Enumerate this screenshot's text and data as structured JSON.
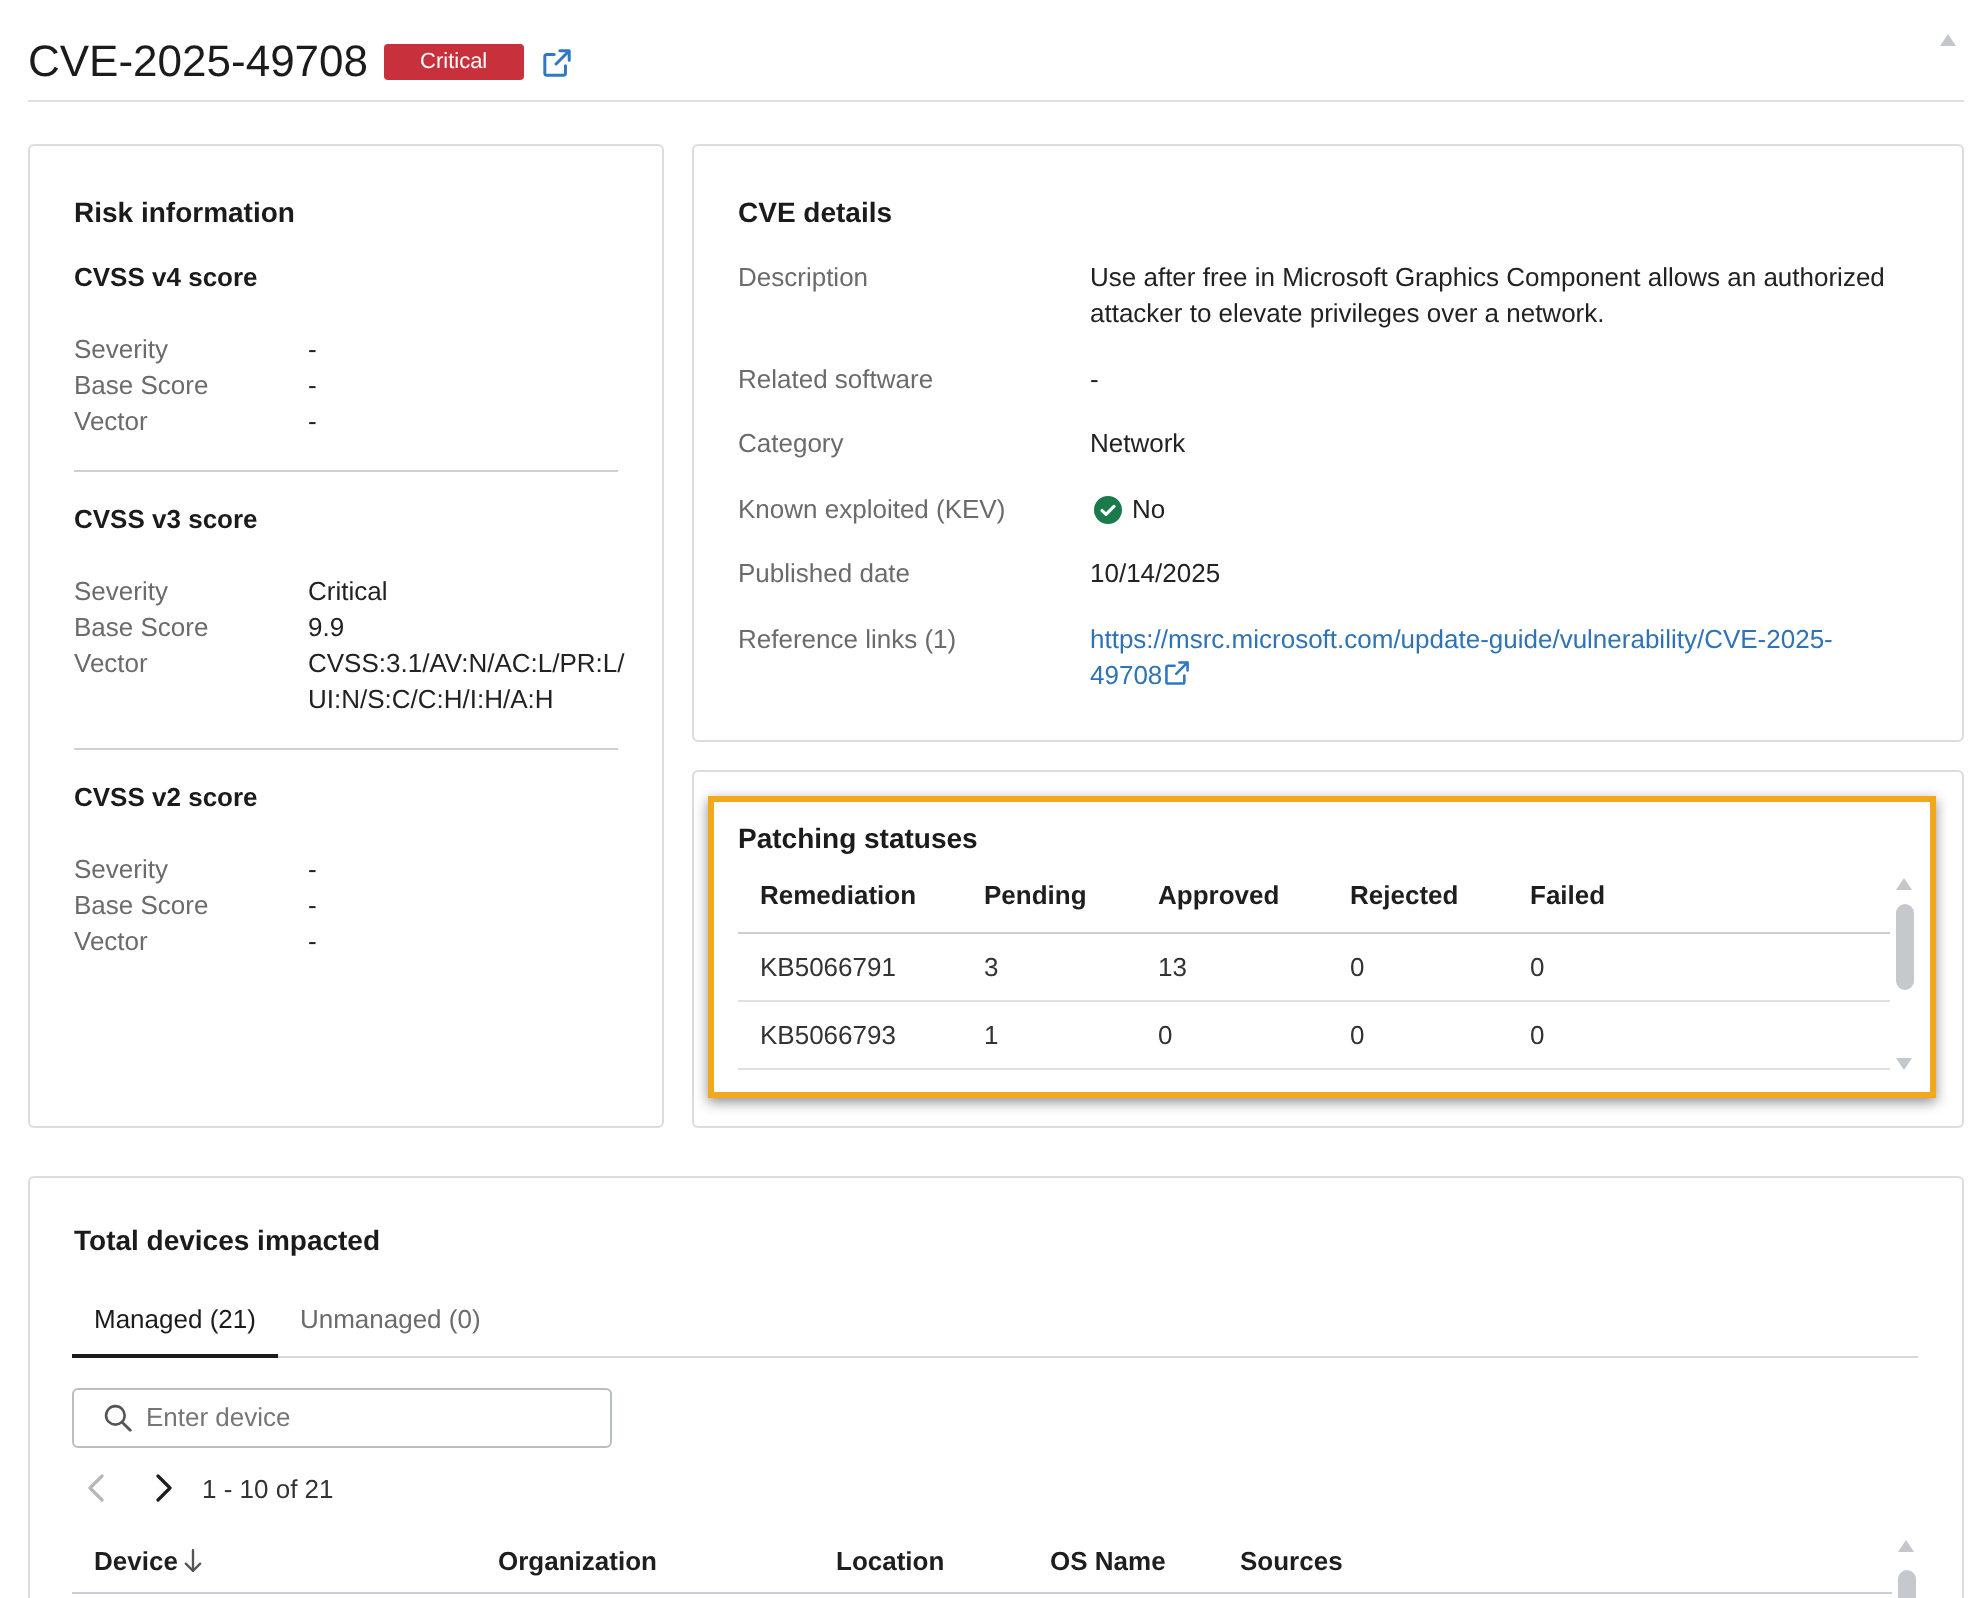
{
  "header": {
    "title": "CVE-2025-49708",
    "severity": "Critical"
  },
  "risk_information": {
    "title": "Risk information",
    "sections": [
      {
        "title": "CVSS v4 score",
        "fields": [
          {
            "label": "Severity",
            "value": "-"
          },
          {
            "label": "Base Score",
            "value": "-"
          },
          {
            "label": "Vector",
            "value": "-"
          }
        ]
      },
      {
        "title": "CVSS v3 score",
        "fields": [
          {
            "label": "Severity",
            "value": "Critical"
          },
          {
            "label": "Base Score",
            "value": "9.9"
          },
          {
            "label": "Vector",
            "value": "CVSS:3.1/AV:N/AC:L/PR:L/UI:N/S:C/C:H/I:H/A:H"
          }
        ]
      },
      {
        "title": "CVSS v2 score",
        "fields": [
          {
            "label": "Severity",
            "value": "-"
          },
          {
            "label": "Base Score",
            "value": "-"
          },
          {
            "label": "Vector",
            "value": "-"
          }
        ]
      }
    ]
  },
  "cve_details": {
    "title": "CVE details",
    "fields": [
      {
        "kind": "text",
        "label": "Description",
        "value": "Use after free in Microsoft Graphics Component allows an authorized attacker to elevate privileges over a network."
      },
      {
        "kind": "text",
        "label": "Related software",
        "value": "-"
      },
      {
        "kind": "text",
        "label": "Category",
        "value": "Network"
      },
      {
        "kind": "status",
        "label": "Known exploited (KEV)",
        "value": "No"
      },
      {
        "kind": "text",
        "label": "Published date",
        "value": "10/14/2025"
      },
      {
        "kind": "link",
        "label": "Reference links (1)",
        "value": "https://msrc.microsoft.com/update-guide/vulnerability/CVE-2025-49708"
      }
    ]
  },
  "patching_statuses": {
    "title": "Patching statuses",
    "highlighted": true,
    "table": {
      "columns": [
        "Remediation",
        "Pending",
        "Approved",
        "Rejected",
        "Failed"
      ],
      "rows": [
        [
          "KB5066791",
          "3",
          "13",
          "0",
          "0"
        ],
        [
          "KB5066793",
          "1",
          "0",
          "0",
          "0"
        ]
      ]
    }
  },
  "devices_impacted": {
    "title": "Total devices impacted",
    "tabs": [
      {
        "label": "Managed (21)",
        "selected": true
      },
      {
        "label": "Unmanaged (0)",
        "selected": false
      }
    ],
    "search": {
      "placeholder": "Enter device"
    },
    "pagination": {
      "previous": {
        "disabled": true
      },
      "next": {
        "disabled": false
      },
      "range": "1 - 10 of 21"
    },
    "table": {
      "columns": [
        {
          "label": "Device",
          "sorted": true
        },
        {
          "label": "Organization",
          "sorted": false
        },
        {
          "label": "Location",
          "sorted": false
        },
        {
          "label": "OS Name",
          "sorted": false
        },
        {
          "label": "Sources",
          "sorted": false
        }
      ]
    }
  }
}
